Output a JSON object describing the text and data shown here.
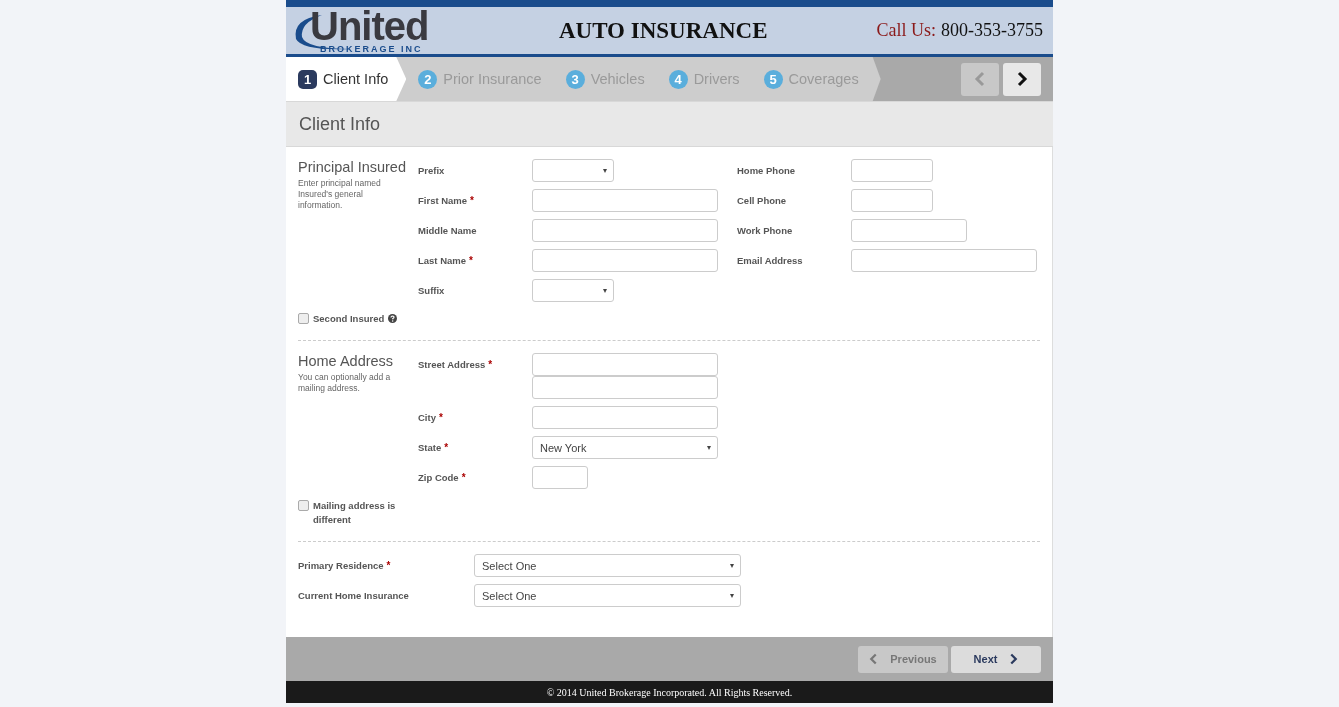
{
  "header": {
    "logo_name": "United",
    "logo_sub": "BROKERAGE INC",
    "title": "AUTO INSURANCE",
    "call_label": "Call Us:",
    "phone": "800-353-3755"
  },
  "steps": [
    {
      "number": "1",
      "label": "Client Info",
      "selected": true
    },
    {
      "number": "2",
      "label": "Prior Insurance",
      "selected": false
    },
    {
      "number": "3",
      "label": "Vehicles",
      "selected": false
    },
    {
      "number": "4",
      "label": "Drivers",
      "selected": false
    },
    {
      "number": "5",
      "label": "Coverages",
      "selected": false
    }
  ],
  "top_nav": {
    "previous_disabled": true,
    "next_disabled": false
  },
  "page_title": "Client Info",
  "required_mark": "*",
  "principal": {
    "title": "Principal Insured",
    "description": "Enter principal named Insured's general information.",
    "left_fields": [
      {
        "label": "Prefix",
        "required": false,
        "kind": "select"
      },
      {
        "label": "First Name",
        "required": true,
        "kind": "text"
      },
      {
        "label": "Middle Name",
        "required": false,
        "kind": "text"
      },
      {
        "label": "Last Name",
        "required": true,
        "kind": "text"
      },
      {
        "label": "Suffix",
        "required": false,
        "kind": "select"
      }
    ],
    "right_fields": [
      {
        "label": "Home Phone",
        "required": false,
        "kind": "text"
      },
      {
        "label": "Cell Phone",
        "required": false,
        "kind": "text"
      },
      {
        "label": "Work Phone",
        "required": false,
        "kind": "text"
      },
      {
        "label": "Email Address",
        "required": false,
        "kind": "text"
      }
    ],
    "checkbox": {
      "label": "Second Insured",
      "checked": false,
      "help": true
    }
  },
  "address": {
    "title": "Home Address",
    "description": "You can optionally add a mailing address.",
    "fields": [
      {
        "label": "Street Address",
        "required": true,
        "kind": "address"
      },
      {
        "label": "City",
        "required": true,
        "kind": "text"
      },
      {
        "label": "State",
        "required": true,
        "kind": "select",
        "value": "New York"
      },
      {
        "label": "Zip Code",
        "required": true,
        "kind": "text"
      }
    ],
    "checkbox": {
      "label": "Mailing address is different",
      "checked": false,
      "help": false
    }
  },
  "residence": [
    {
      "label": "Primary Residence",
      "required": true,
      "kind": "select",
      "value": "Select One"
    },
    {
      "label": "Current Home Insurance",
      "required": false,
      "kind": "select",
      "value": "Select One"
    }
  ],
  "footer_buttons": [
    {
      "label": "Previous",
      "kind": "previous",
      "disabled": true
    },
    {
      "label": "Next",
      "kind": "next",
      "disabled": false
    }
  ],
  "copyright": "© 2014 United Brokerage Incorporated. All Rights Reserved."
}
